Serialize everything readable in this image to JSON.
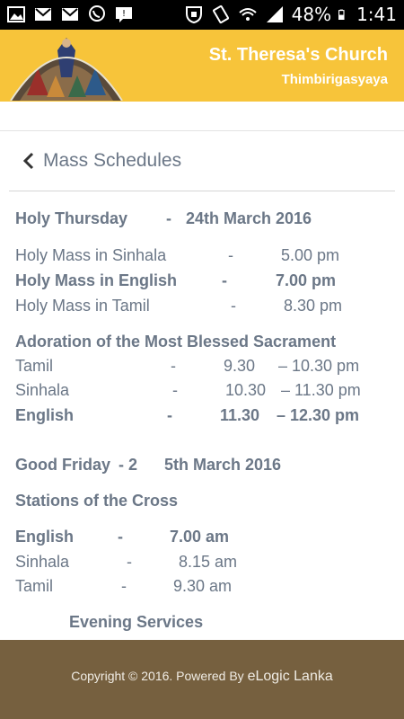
{
  "status_bar": {
    "battery": "48%",
    "time": "1:41"
  },
  "header": {
    "church_name": "St. Theresa's Church",
    "location": "Thimbirigasyaya"
  },
  "nav": {
    "title": "Mass Schedules"
  },
  "schedule": {
    "holy_thursday": {
      "day": "Holy Thursday",
      "dash": "-",
      "date": "24th March 2016",
      "masses": [
        {
          "name": "Holy Mass in Sinhala",
          "dash": "-",
          "time": "5.00 pm"
        },
        {
          "name": "Holy Mass in English",
          "dash": "-",
          "time": "7.00 pm"
        },
        {
          "name": "Holy Mass in Tamil",
          "dash": "-",
          "time": "8.30 pm"
        }
      ],
      "adoration_title": "Adoration of the Most Blessed Sacrament",
      "adoration": [
        {
          "lang": "Tamil",
          "dash": "-",
          "start": "9.30",
          "end": "– 10.30 pm"
        },
        {
          "lang": "Sinhala",
          "dash": "-",
          "start": "10.30",
          "end": "– 11.30 pm"
        },
        {
          "lang": "English",
          "dash": "-",
          "start": "11.30",
          "end": "– 12.30 pm"
        }
      ]
    },
    "good_friday": {
      "day": "Good Friday",
      "dash": "- 2",
      "date": "5th March 2016",
      "stations_title": "Stations of the Cross",
      "stations": [
        {
          "lang": "English",
          "dash": "-",
          "time": "7.00 am"
        },
        {
          "lang": "Sinhala",
          "dash": "-",
          "time": "8.15 am"
        },
        {
          "lang": "Tamil",
          "dash": "-",
          "time": "9.30 am"
        }
      ],
      "evening_title": "Evening Services"
    }
  },
  "footer": {
    "copyright": "Copyright © 2016. Powered By ",
    "brand": "eLogic Lanka"
  },
  "colors": {
    "header": "#f7c43a",
    "text": "#6b7787",
    "footer": "#76603f"
  }
}
